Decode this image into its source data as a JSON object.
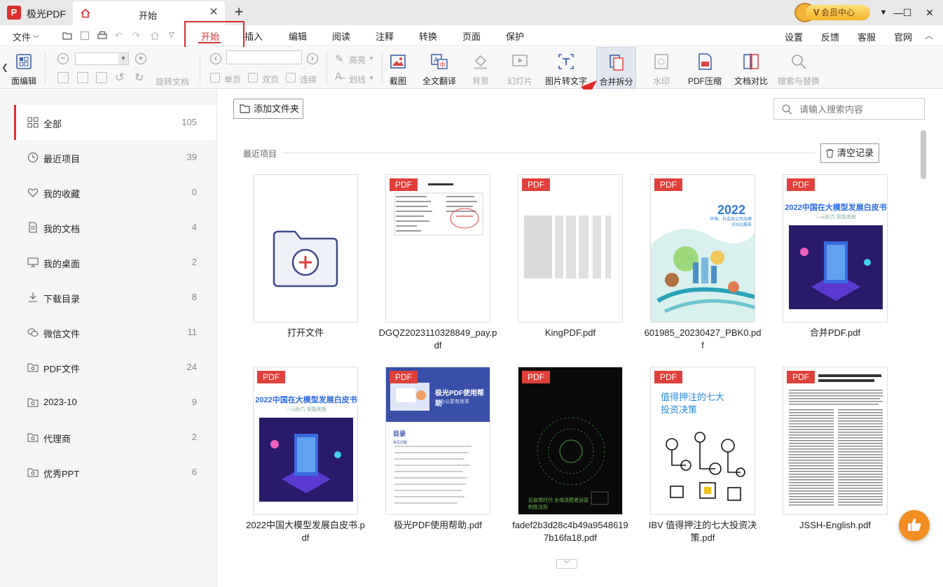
{
  "app": {
    "title": "极光PDF",
    "logo_letter": "P"
  },
  "tabs": [
    {
      "title": "开始"
    }
  ],
  "vip": {
    "label": "会员中心",
    "v": "V"
  },
  "menu": {
    "file": "文件",
    "tabs": [
      "开始",
      "插入",
      "编辑",
      "阅读",
      "注释",
      "转换",
      "页面",
      "保护"
    ],
    "active_tab": "开始",
    "right": [
      "设置",
      "反馈",
      "客服",
      "官网"
    ]
  },
  "toolbar": {
    "page_edit": "面编辑",
    "rotate_doc": "旋转文档",
    "single_page": "单页",
    "double_page": "双页",
    "continuous": "连续",
    "highlight": "高亮",
    "strikeout": "划线",
    "screenshot": "截图",
    "full_translate": "全文翻译",
    "background": "背景",
    "slideshow": "幻灯片",
    "img_to_text": "图片转文字",
    "merge_split": "合并拆分",
    "watermark": "水印",
    "pdf_compress": "PDF压缩",
    "doc_compare": "文档对比",
    "search_replace": "搜索与替换"
  },
  "sidebar": {
    "items": [
      {
        "label": "全部",
        "count": "105",
        "icon": "grid-icon"
      },
      {
        "label": "最近项目",
        "count": "39",
        "icon": "clock-icon"
      },
      {
        "label": "我的收藏",
        "count": "0",
        "icon": "heart-icon"
      },
      {
        "label": "我的文档",
        "count": "4",
        "icon": "document-icon"
      },
      {
        "label": "我的桌面",
        "count": "2",
        "icon": "monitor-icon"
      },
      {
        "label": "下载目录",
        "count": "8",
        "icon": "download-icon"
      },
      {
        "label": "微信文件",
        "count": "11",
        "icon": "wechat-icon"
      },
      {
        "label": "PDF文件",
        "count": "24",
        "icon": "folder-icon"
      },
      {
        "label": "2023-10",
        "count": "9",
        "icon": "folder-icon"
      },
      {
        "label": "代理商",
        "count": "2",
        "icon": "folder-icon"
      },
      {
        "label": "优秀PPT",
        "count": "6",
        "icon": "folder-icon"
      }
    ]
  },
  "main": {
    "add_folder": "添加文件夹",
    "search_placeholder": "请输入搜索内容",
    "recent_label": "最近项目",
    "clear_records": "清空记录",
    "pdf_badge": "PDF",
    "files": [
      {
        "name": "打开文件"
      },
      {
        "name": "DGQZ2023110328849_pay.pdf"
      },
      {
        "name": "KingPDF.pdf"
      },
      {
        "name": "601985_20230427_PBK0.pdf"
      },
      {
        "name": "合并PDF.pdf"
      },
      {
        "name": "2022中国大模型发展白皮书.pdf"
      },
      {
        "name": "极光PDF使用帮助.pdf"
      },
      {
        "name": "fadef2b3d28c4b49a95486197b16fa18.pdf"
      },
      {
        "name": "IBV 值得押注的七大投资决策.pdf"
      },
      {
        "name": "JSSH-English.pdf"
      }
    ],
    "thumb_text": {
      "esg_year": "2022",
      "esg_title": "环境、社会及公司治理(ESG)报告",
      "bigmodel_title": "2022中国在大模型发展白皮书",
      "bigmodel_sub": "—元耐力 智能底座",
      "help_title": "极光PDF使用帮助",
      "help_sub": "让办公更有效率",
      "help_toc": "目录",
      "help_faq": "常见问题",
      "ibv_title": "值得押注的七大投资决策",
      "dark_text": "后疫情时代 全域消费者运营制胜法则"
    }
  },
  "colors": {
    "accent": "#d9302f",
    "badge": "#e0403b",
    "vip": "#f4b42a",
    "like": "#f28d22"
  }
}
